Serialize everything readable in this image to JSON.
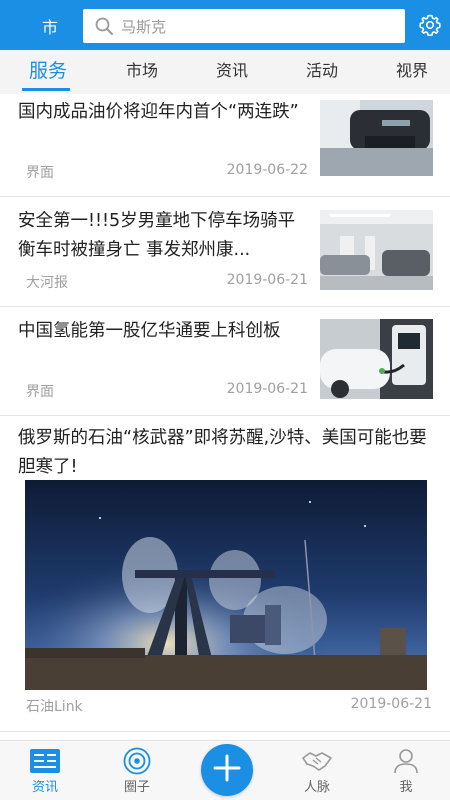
{
  "header": {
    "city": "市",
    "search_placeholder": "马斯克",
    "search_icon": "search-icon",
    "settings_icon": "gear-icon",
    "bg_color": "#1a8fe3"
  },
  "tabs": [
    {
      "label": "服务",
      "active": true
    },
    {
      "label": "市场",
      "active": false
    },
    {
      "label": "资讯",
      "active": false
    },
    {
      "label": "活动",
      "active": false
    },
    {
      "label": "视界",
      "active": false
    }
  ],
  "news": [
    {
      "title": "国内成品油价将迎年内首个“两连跌”",
      "source": "界面",
      "date": "2019-06-22"
    },
    {
      "title": "安全第一!!!5岁男童地下停车场骑平衡车时被撞身亡 事发郑州康...",
      "source": "大河报",
      "date": "2019-06-21"
    },
    {
      "title": "中国氢能第一股亿华通要上科创板",
      "source": "界面",
      "date": "2019-06-21"
    },
    {
      "title": "俄罗斯的石油“核武器”即将苏醒,沙特、美国可能也要胆寒了!",
      "source": "石油Link",
      "date": "2019-06-21"
    }
  ],
  "bottom_nav": [
    {
      "label": "资讯",
      "icon": "news-icon",
      "active": true
    },
    {
      "label": "圈子",
      "icon": "circle-icon",
      "active": false
    },
    {
      "label": "",
      "icon": "plus-icon",
      "active": false
    },
    {
      "label": "人脉",
      "icon": "handshake-icon",
      "active": false
    },
    {
      "label": "我",
      "icon": "person-icon",
      "active": false
    }
  ],
  "accent_color": "#1a8fe3"
}
